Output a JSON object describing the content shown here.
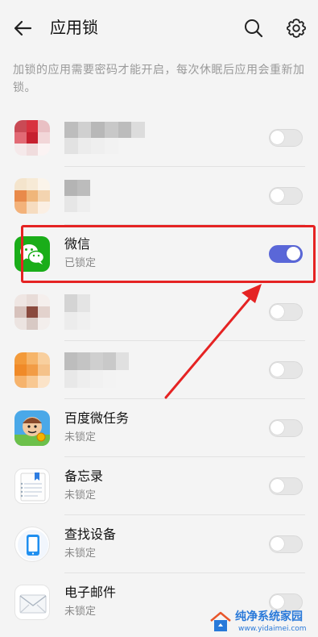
{
  "header": {
    "title": "应用锁",
    "back_icon": "back-arrow-icon",
    "search_icon": "search-icon",
    "settings_icon": "gear-icon"
  },
  "description": "加锁的应用需要密码才能开启，每次休眠后应用会重新加锁。",
  "apps": [
    {
      "name": "",
      "status": "",
      "locked": false,
      "icon": "blurred-app-icon"
    },
    {
      "name": "",
      "status": "",
      "locked": false,
      "icon": "blurred-app-icon"
    },
    {
      "name": "微信",
      "status": "已锁定",
      "locked": true,
      "icon": "wechat-icon"
    },
    {
      "name": "",
      "status": "",
      "locked": false,
      "icon": "blurred-app-icon"
    },
    {
      "name": "",
      "status": "",
      "locked": false,
      "icon": "blurred-app-icon"
    },
    {
      "name": "百度微任务",
      "status": "未锁定",
      "locked": false,
      "icon": "baidu-task-icon"
    },
    {
      "name": "备忘录",
      "status": "未锁定",
      "locked": false,
      "icon": "notes-icon"
    },
    {
      "name": "查找设备",
      "status": "未锁定",
      "locked": false,
      "icon": "find-device-icon"
    },
    {
      "name": "电子邮件",
      "status": "未锁定",
      "locked": false,
      "icon": "email-icon"
    }
  ],
  "colors": {
    "toggle_on": "#5a67d8",
    "toggle_off": "#e6e6e6",
    "annotation_red": "#e52323",
    "wechat_green": "#1aad19"
  },
  "watermark": {
    "title": "纯净系统家园",
    "url": "www.yidaimei.com"
  }
}
